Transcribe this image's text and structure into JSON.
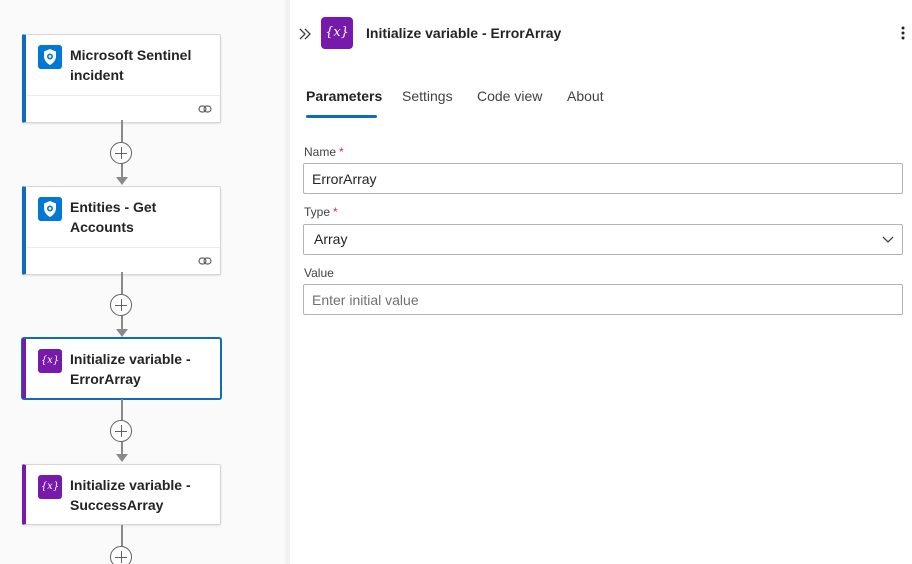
{
  "canvas": {
    "cards": [
      {
        "title_line1": "Microsoft Sentinel",
        "title_line2": "incident",
        "icon": "sentinel-shield-icon"
      },
      {
        "title_line1": "Entities - Get",
        "title_line2": "Accounts",
        "icon": "sentinel-shield-icon"
      },
      {
        "title_line1": "Initialize variable -",
        "title_line2": "ErrorArray",
        "icon": "variable-icon",
        "icon_text": "{x}"
      },
      {
        "title_line1": "Initialize variable -",
        "title_line2": "SuccessArray",
        "icon": "variable-icon",
        "icon_text": "{x}"
      }
    ]
  },
  "panel": {
    "title": "Initialize variable - ErrorArray",
    "header_icon_text": "{x}",
    "tabs": [
      {
        "label": "Parameters",
        "active": true
      },
      {
        "label": "Settings",
        "active": false
      },
      {
        "label": "Code view",
        "active": false
      },
      {
        "label": "About",
        "active": false
      }
    ],
    "fields": {
      "name": {
        "label": "Name",
        "required_mark": "*",
        "value": "ErrorArray"
      },
      "type": {
        "label": "Type",
        "required_mark": "*",
        "value": "Array"
      },
      "value": {
        "label": "Value",
        "placeholder": "Enter initial value"
      }
    }
  },
  "colors": {
    "sentinel_accent": "#0f6cbd",
    "variable_accent": "#7719aa"
  }
}
